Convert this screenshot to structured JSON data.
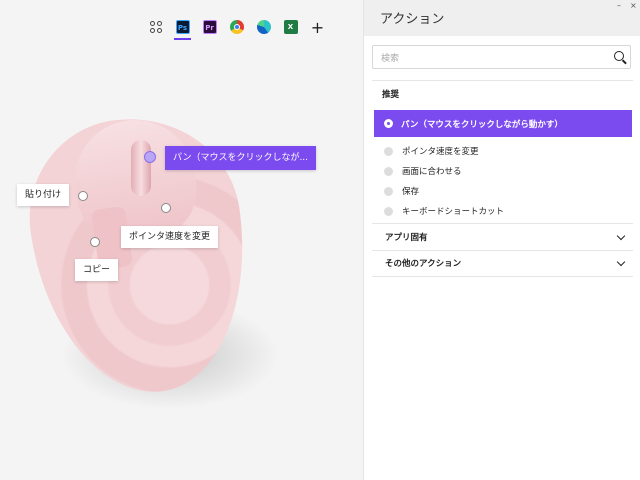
{
  "app_bar": {
    "apps": [
      {
        "name": "all-apps",
        "icon": "grid-icon"
      },
      {
        "name": "photoshop",
        "icon": "photoshop-icon",
        "text": "Ps",
        "active": true
      },
      {
        "name": "premiere",
        "icon": "premiere-icon",
        "text": "Pr"
      },
      {
        "name": "chrome",
        "icon": "chrome-icon"
      },
      {
        "name": "edge",
        "icon": "edge-icon"
      },
      {
        "name": "excel",
        "icon": "excel-icon",
        "text": "X"
      },
      {
        "name": "add",
        "icon": "plus-icon",
        "text": "+"
      }
    ]
  },
  "mouse": {
    "labels": {
      "pan": "パン（マウスをクリックしなが...",
      "paste": "貼り付け",
      "pointer_speed": "ポインタ速度を変更",
      "copy": "コピー"
    }
  },
  "panel": {
    "title": "アクション",
    "search_placeholder": "検索",
    "recommended_title": "推奨",
    "selected_action": "パン（マウスをクリックしながら動かす）",
    "options": [
      "ポインタ速度を変更",
      "画面に合わせる",
      "保存",
      "キーボードショートカット"
    ],
    "app_specific": "アプリ固有",
    "other_actions": "その他のアクション",
    "window_controls": {
      "minimize": "–",
      "close": "×"
    }
  },
  "colors": {
    "accent": "#7b4bf0",
    "mouse_pink": "#f3d3d6",
    "panel_header": "#efefef"
  }
}
